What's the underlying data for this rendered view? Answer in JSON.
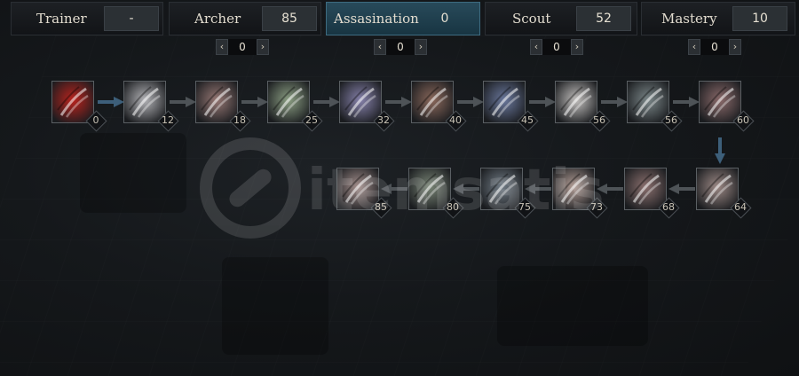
{
  "tabs": [
    {
      "name": "Trainer",
      "value": "-",
      "active": false
    },
    {
      "name": "Archer",
      "value": "85",
      "active": false
    },
    {
      "name": "Assasination",
      "value": "0",
      "active": true
    },
    {
      "name": "Scout",
      "value": "52",
      "active": false
    },
    {
      "name": "Mastery",
      "value": "10",
      "active": false
    }
  ],
  "steppers": [
    {
      "left": "‹",
      "value": "0",
      "right": "›"
    },
    {
      "left": "‹",
      "value": "0",
      "right": "›"
    },
    {
      "left": "‹",
      "value": "0",
      "right": "›"
    },
    {
      "left": "‹",
      "value": "0",
      "right": "›"
    }
  ],
  "skills_row1": [
    {
      "level": "0",
      "icon": "claw-slash-icon",
      "color": "#c0221c"
    },
    {
      "level": "12",
      "icon": "feather-slash-icon",
      "color": "#b8b8bc"
    },
    {
      "level": "18",
      "icon": "triple-claw-icon",
      "color": "#9a7a76"
    },
    {
      "level": "25",
      "icon": "green-slash-icon",
      "color": "#8fa386"
    },
    {
      "level": "32",
      "icon": "violet-burst-icon",
      "color": "#8a85b0"
    },
    {
      "level": "40",
      "icon": "brown-claw-icon",
      "color": "#8e6a5c"
    },
    {
      "level": "45",
      "icon": "purple-orb-icon",
      "color": "#6c7aa0"
    },
    {
      "level": "56",
      "icon": "white-slash-icon",
      "color": "#c9c6c4"
    },
    {
      "level": "56",
      "icon": "armor-icon",
      "color": "#7e8a8c"
    },
    {
      "level": "60",
      "icon": "shadow-figure-icon",
      "color": "#8e6c6c"
    }
  ],
  "skills_row2": [
    {
      "level": "85",
      "icon": "pale-burst-icon",
      "color": "#a99390"
    },
    {
      "level": "80",
      "icon": "vine-icon",
      "color": "#7c8878"
    },
    {
      "level": "75",
      "icon": "spike-burst-icon",
      "color": "#75808a"
    },
    {
      "level": "73",
      "icon": "hooded-face-icon",
      "color": "#b8a29a"
    },
    {
      "level": "68",
      "icon": "dagger-icon",
      "color": "#8e7270"
    },
    {
      "level": "64",
      "icon": "fist-icon",
      "color": "#a08c88"
    }
  ],
  "watermark": {
    "brand": "itemsatis",
    "color": "#ffffff"
  }
}
